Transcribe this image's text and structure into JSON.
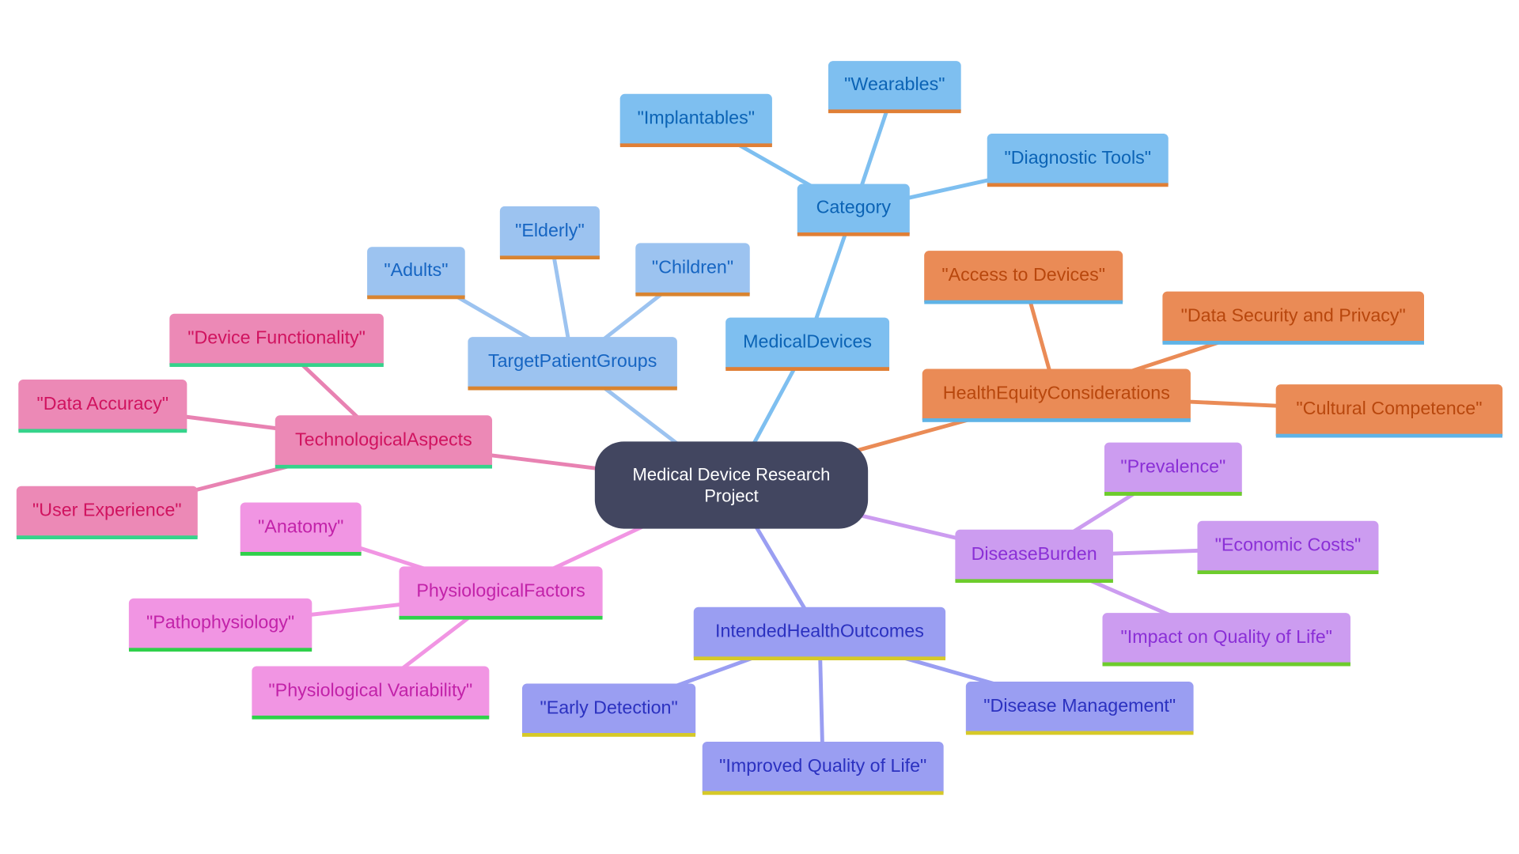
{
  "diagram": {
    "type": "mindmap",
    "root": {
      "label": "Medical Device Research Project"
    },
    "branches": {
      "medical_devices": {
        "label": "MedicalDevices",
        "category": {
          "label": "Category",
          "children": [
            "\"Implantables\"",
            "\"Wearables\"",
            "\"Diagnostic Tools\""
          ]
        }
      },
      "target_patient_groups": {
        "label": "TargetPatientGroups",
        "children": [
          "\"Adults\"",
          "\"Elderly\"",
          "\"Children\""
        ]
      },
      "health_equity": {
        "label": "HealthEquityConsiderations",
        "children": [
          "\"Access to Devices\"",
          "\"Data Security and Privacy\"",
          "\"Cultural Competence\""
        ]
      },
      "disease_burden": {
        "label": "DiseaseBurden",
        "children": [
          "\"Prevalence\"",
          "\"Economic Costs\"",
          "\"Impact on Quality of Life\""
        ]
      },
      "intended_health_outcomes": {
        "label": "IntendedHealthOutcomes",
        "children": [
          "\"Early Detection\"",
          "\"Improved Quality of Life\"",
          "\"Disease Management\""
        ]
      },
      "physiological_factors": {
        "label": "PhysiologicalFactors",
        "children": [
          "\"Anatomy\"",
          "\"Pathophysiology\"",
          "\"Physiological Variability\""
        ]
      },
      "technological_aspects": {
        "label": "TechnologicalAspects",
        "children": [
          "\"Device Functionality\"",
          "\"Data Accuracy\"",
          "\"User Experience\""
        ]
      }
    }
  },
  "colors": {
    "root": "#424660",
    "medical_devices": "#7ebff0",
    "target_patient_groups": "#9cc3f0",
    "health_equity": "#ea8b56",
    "technological_aspects": "#ec89b6",
    "physiological_factors": "#f195e3",
    "disease_burden": "#cc9cf0",
    "intended_health_outcomes": "#9a9ef2"
  }
}
